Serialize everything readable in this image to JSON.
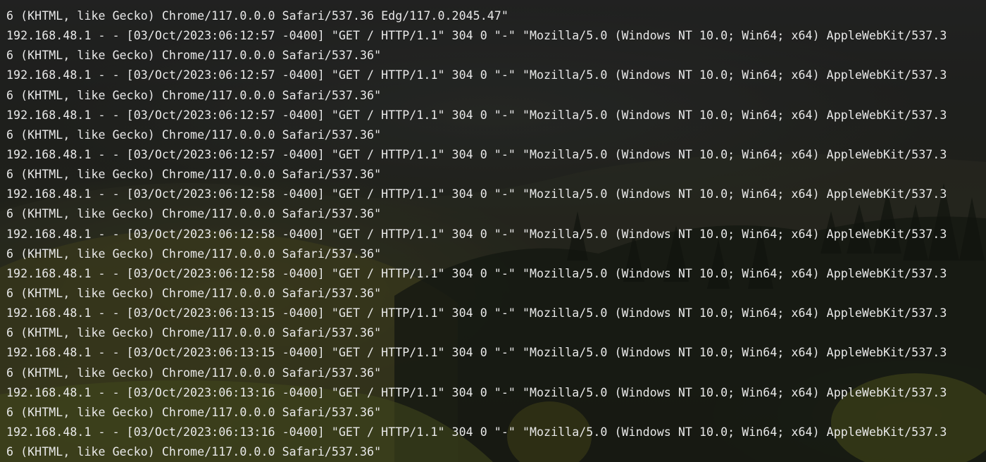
{
  "terminal": {
    "lines": [
      "6 (KHTML, like Gecko) Chrome/117.0.0.0 Safari/537.36 Edg/117.0.2045.47\"",
      "192.168.48.1 - - [03/Oct/2023:06:12:57 -0400] \"GET / HTTP/1.1\" 304 0 \"-\" \"Mozilla/5.0 (Windows NT 10.0; Win64; x64) AppleWebKit/537.3",
      "6 (KHTML, like Gecko) Chrome/117.0.0.0 Safari/537.36\"",
      "192.168.48.1 - - [03/Oct/2023:06:12:57 -0400] \"GET / HTTP/1.1\" 304 0 \"-\" \"Mozilla/5.0 (Windows NT 10.0; Win64; x64) AppleWebKit/537.3",
      "6 (KHTML, like Gecko) Chrome/117.0.0.0 Safari/537.36\"",
      "192.168.48.1 - - [03/Oct/2023:06:12:57 -0400] \"GET / HTTP/1.1\" 304 0 \"-\" \"Mozilla/5.0 (Windows NT 10.0; Win64; x64) AppleWebKit/537.3",
      "6 (KHTML, like Gecko) Chrome/117.0.0.0 Safari/537.36\"",
      "192.168.48.1 - - [03/Oct/2023:06:12:57 -0400] \"GET / HTTP/1.1\" 304 0 \"-\" \"Mozilla/5.0 (Windows NT 10.0; Win64; x64) AppleWebKit/537.3",
      "6 (KHTML, like Gecko) Chrome/117.0.0.0 Safari/537.36\"",
      "192.168.48.1 - - [03/Oct/2023:06:12:58 -0400] \"GET / HTTP/1.1\" 304 0 \"-\" \"Mozilla/5.0 (Windows NT 10.0; Win64; x64) AppleWebKit/537.3",
      "6 (KHTML, like Gecko) Chrome/117.0.0.0 Safari/537.36\"",
      "192.168.48.1 - - [03/Oct/2023:06:12:58 -0400] \"GET / HTTP/1.1\" 304 0 \"-\" \"Mozilla/5.0 (Windows NT 10.0; Win64; x64) AppleWebKit/537.3",
      "6 (KHTML, like Gecko) Chrome/117.0.0.0 Safari/537.36\"",
      "192.168.48.1 - - [03/Oct/2023:06:12:58 -0400] \"GET / HTTP/1.1\" 304 0 \"-\" \"Mozilla/5.0 (Windows NT 10.0; Win64; x64) AppleWebKit/537.3",
      "6 (KHTML, like Gecko) Chrome/117.0.0.0 Safari/537.36\"",
      "192.168.48.1 - - [03/Oct/2023:06:13:15 -0400] \"GET / HTTP/1.1\" 304 0 \"-\" \"Mozilla/5.0 (Windows NT 10.0; Win64; x64) AppleWebKit/537.3",
      "6 (KHTML, like Gecko) Chrome/117.0.0.0 Safari/537.36\"",
      "192.168.48.1 - - [03/Oct/2023:06:13:15 -0400] \"GET / HTTP/1.1\" 304 0 \"-\" \"Mozilla/5.0 (Windows NT 10.0; Win64; x64) AppleWebKit/537.3",
      "6 (KHTML, like Gecko) Chrome/117.0.0.0 Safari/537.36\"",
      "192.168.48.1 - - [03/Oct/2023:06:13:16 -0400] \"GET / HTTP/1.1\" 304 0 \"-\" \"Mozilla/5.0 (Windows NT 10.0; Win64; x64) AppleWebKit/537.3",
      "6 (KHTML, like Gecko) Chrome/117.0.0.0 Safari/537.36\"",
      "192.168.48.1 - - [03/Oct/2023:06:13:16 -0400] \"GET / HTTP/1.1\" 304 0 \"-\" \"Mozilla/5.0 (Windows NT 10.0; Win64; x64) AppleWebKit/537.3",
      "6 (KHTML, like Gecko) Chrome/117.0.0.0 Safari/537.36\""
    ],
    "text_color": "#e9e9e9"
  }
}
